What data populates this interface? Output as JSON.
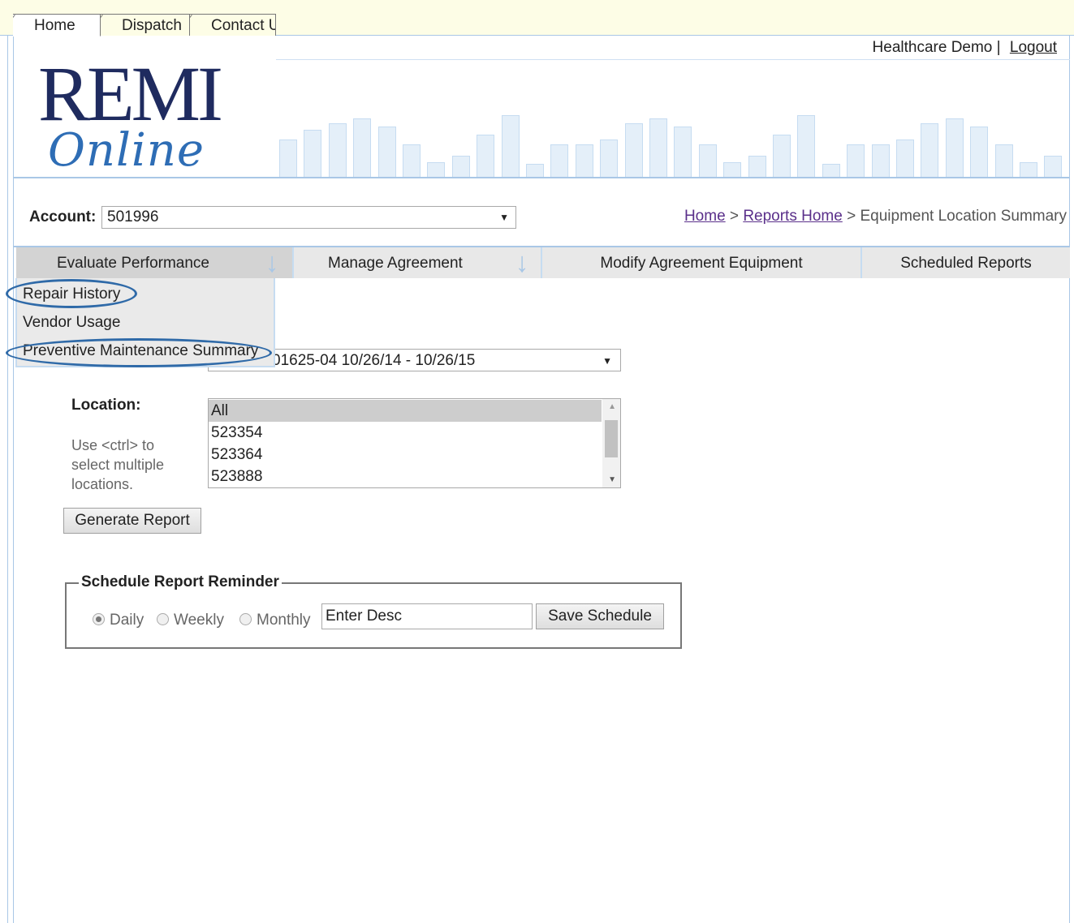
{
  "tabs": [
    "Home",
    "Dispatch",
    "Contact U"
  ],
  "header": {
    "user_name": "Healthcare Demo",
    "separator": "|",
    "logout_label": "Logout",
    "logo_text_top": "REMI",
    "logo_text_bottom": "Online"
  },
  "account": {
    "label": "Account:",
    "selected": "501996"
  },
  "breadcrumb": {
    "home": "Home",
    "sep": ">",
    "reports_home": "Reports Home",
    "current": "Equipment Location Summary"
  },
  "menu": {
    "items": [
      "Evaluate Performance",
      "Manage Agreement",
      "Modify Agreement Equipment",
      "Scheduled Reports"
    ],
    "dropdown": [
      "Repair History",
      "Vendor Usage",
      "Preventive Maintenance Summary"
    ]
  },
  "agreement": {
    "selected_visible": "01625-04 10/26/14 - 10/26/15"
  },
  "location": {
    "label": "Location:",
    "hint": "Use <ctrl> to select multiple locations.",
    "options": [
      "All",
      "523354",
      "523364",
      "523888"
    ]
  },
  "generate_button": "Generate Report",
  "schedule": {
    "legend": "Schedule Report Reminder",
    "options": [
      "Daily",
      "Weekly",
      "Monthly"
    ],
    "selected": "Daily",
    "desc_value": "Enter Desc",
    "save_button": "Save Schedule"
  },
  "colors": {
    "tab_bg": "#fdfde6",
    "frame_blue": "#a9c7e6",
    "logo_navy": "#1f2b5f",
    "logo_blue": "#2e6db5",
    "link_purple": "#5a2f8a",
    "oval_blue": "#2f6aa8"
  }
}
